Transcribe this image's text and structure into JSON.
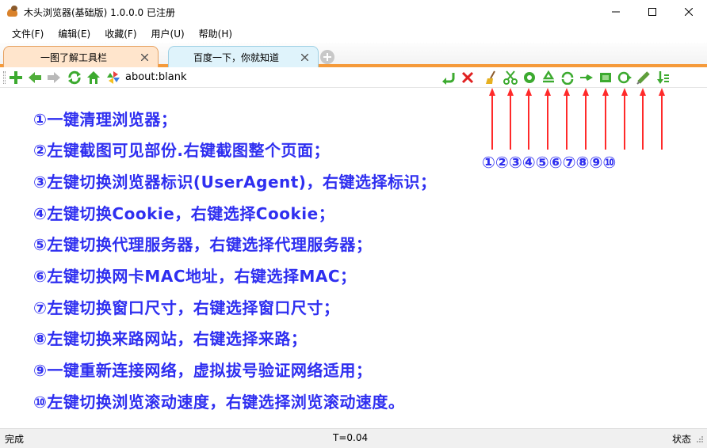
{
  "window": {
    "title": "木头浏览器(基础版) 1.0.0.0  已注册"
  },
  "menu": {
    "items": [
      "文件(F)",
      "编辑(E)",
      "收藏(F)",
      "用户(U)",
      "帮助(H)"
    ]
  },
  "tabs": [
    {
      "label": "一图了解工具栏",
      "active": true
    },
    {
      "label": "百度一下，你就知道",
      "active": false
    }
  ],
  "toolbar": {
    "address": "about:blank",
    "icons_left": [
      "add-icon",
      "back-icon",
      "forward-icon",
      "refresh-icon",
      "home-icon",
      "pinwheel-icon"
    ],
    "icons_right": [
      "go-icon",
      "stop-icon",
      "broom-icon",
      "scissors-icon",
      "useragent-icon",
      "cookie-icon",
      "proxy-icon",
      "mac-icon",
      "window-size-icon",
      "referer-icon",
      "reconnect-icon",
      "scroll-speed-icon"
    ]
  },
  "content": {
    "lines": [
      "①一键清理浏览器；",
      "②左键截图可见部份.右键截图整个页面；",
      "③左键切换浏览器标识(UserAgent)，右键选择标识；",
      "④左键切换Cookie，右键选择Cookie；",
      "⑤左键切换代理服务器，右键选择代理服务器；",
      "⑥左键切换网卡MAC地址，右键选择MAC；",
      "⑦左键切换窗口尺寸，右键选择窗口尺寸；",
      "⑧左键切换来路网站，右键选择来路；",
      "⑨一键重新连接网络，虚拟拔号验证网络适用；",
      "⑩左键切换浏览滚动速度，右键选择浏览滚动速度。"
    ],
    "numbers": "①②③④⑤⑥⑦⑧⑨⑩"
  },
  "status": {
    "left": "完成",
    "middle": "T=0.04",
    "right": "状态"
  },
  "colors": {
    "text_blue": "#2f2ff0",
    "arrow_red": "#ff2a2a",
    "tab_accent": "#f59a3a"
  }
}
